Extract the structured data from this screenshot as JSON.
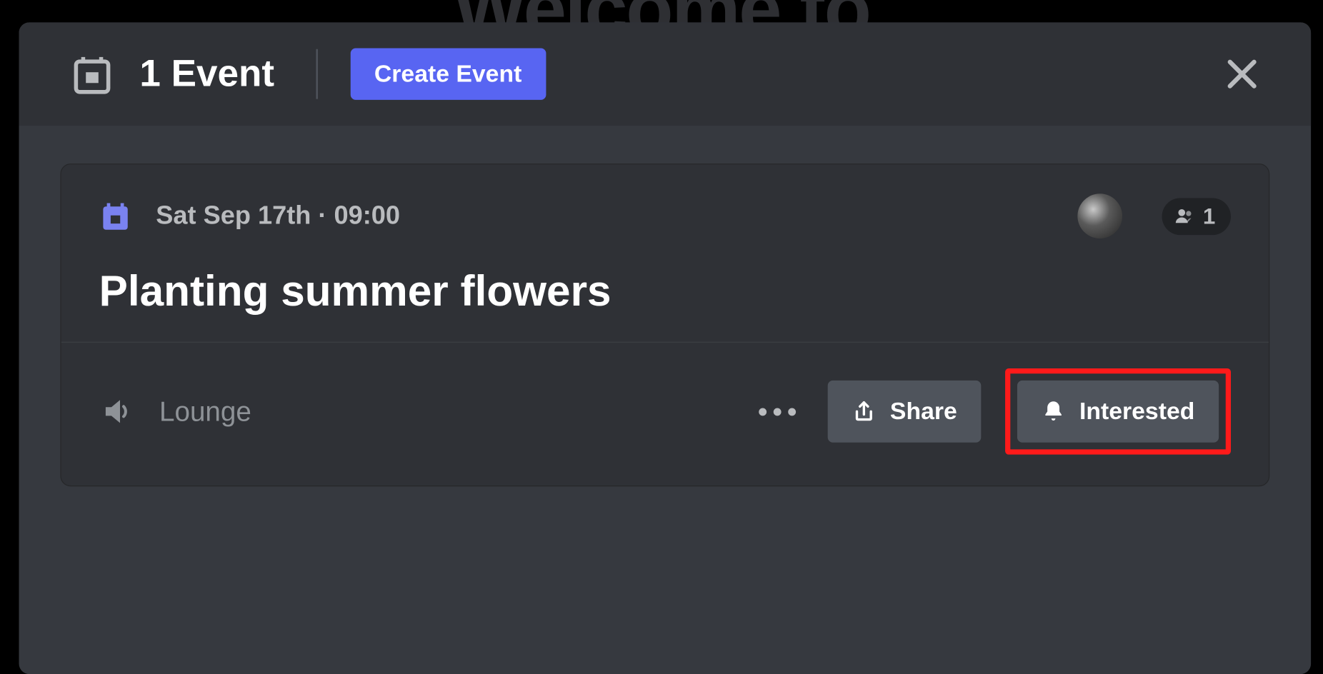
{
  "background": {
    "partial_text": "Welcome to"
  },
  "header": {
    "events_count_label": "1 Event",
    "create_button": "Create Event"
  },
  "event": {
    "date": "Sat Sep 17th",
    "date_separator": "·",
    "time": "09:00",
    "interested_count": "1",
    "title": "Planting summer flowers",
    "channel_name": "Lounge",
    "share_button": "Share",
    "interested_button": "Interested"
  }
}
